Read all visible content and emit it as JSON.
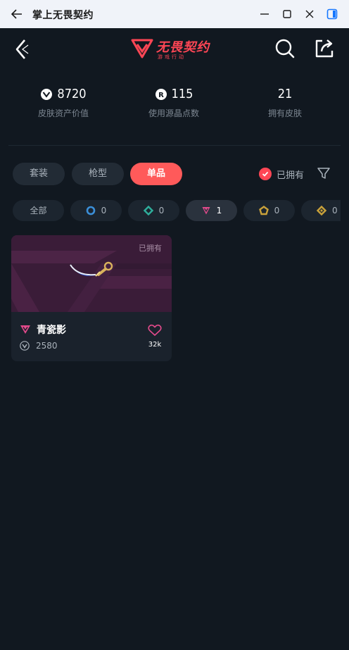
{
  "window": {
    "title": "掌上无畏契约"
  },
  "app": {
    "brand": "无畏契约",
    "brand_sub": "游戏行动"
  },
  "stats": [
    {
      "value": "8720",
      "label": "皮肤资产价值",
      "icon": "vp-icon"
    },
    {
      "value": "115",
      "label": "使用源晶点数",
      "icon": "radianite-icon"
    },
    {
      "value": "21",
      "label": "拥有皮肤",
      "icon": ""
    }
  ],
  "tabs": [
    {
      "label": "套装",
      "active": false
    },
    {
      "label": "枪型",
      "active": false
    },
    {
      "label": "单品",
      "active": true
    }
  ],
  "owned_filter": {
    "label": "已拥有",
    "checked": true
  },
  "rarity_filters": [
    {
      "label": "全部",
      "active": false
    },
    {
      "count": "0",
      "color": "#3b8fd8",
      "icon": "select-tier-icon"
    },
    {
      "count": "0",
      "color": "#2fae9b",
      "icon": "deluxe-tier-icon"
    },
    {
      "count": "1",
      "color": "#e24a8b",
      "icon": "premium-tier-icon",
      "active": true
    },
    {
      "count": "0",
      "color": "#c9a13a",
      "icon": "exclusive-tier-icon"
    },
    {
      "count": "0",
      "color": "#c9a13a",
      "icon": "ultra-tier-icon"
    }
  ],
  "items": [
    {
      "owned_tag": "已拥有",
      "name": "青瓷影",
      "price": "2580",
      "likes": "32k",
      "tier_color": "#e24a8b"
    }
  ],
  "colors": {
    "accent": "#ff4655",
    "bg": "#111820",
    "card": "#1a222c"
  }
}
